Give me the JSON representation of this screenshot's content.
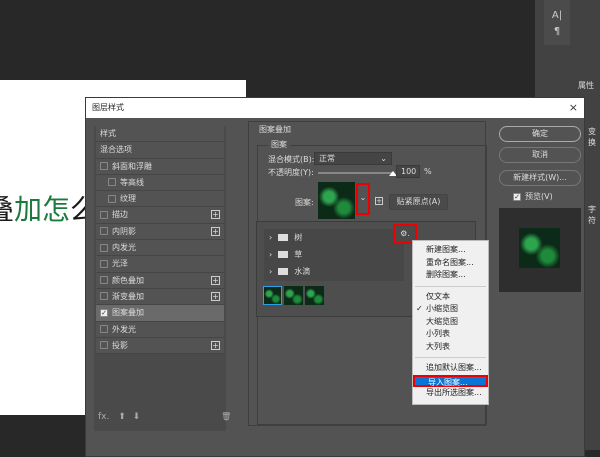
{
  "canvas": {
    "text_before": "叠",
    "text_green": "加怎",
    "text_after": "么"
  },
  "right_panel": {
    "tool_a": "A|",
    "tool_para": "¶",
    "properties_tab": "属性",
    "transform": "变换",
    "character": "字符"
  },
  "dialog": {
    "title": "图层样式",
    "close": "×",
    "styles": [
      {
        "label": "样式",
        "checkbox": false,
        "indent": false,
        "plus": false
      },
      {
        "label": "混合选项",
        "checkbox": false,
        "indent": false,
        "plus": false
      },
      {
        "label": "斜面和浮雕",
        "checkbox": true,
        "checked": false,
        "plus": false
      },
      {
        "label": "等高线",
        "checkbox": true,
        "checked": false,
        "indent": true,
        "plus": false
      },
      {
        "label": "纹理",
        "checkbox": true,
        "checked": false,
        "indent": true,
        "plus": false
      },
      {
        "label": "描边",
        "checkbox": true,
        "checked": false,
        "plus": true
      },
      {
        "label": "内阴影",
        "checkbox": true,
        "checked": false,
        "plus": true
      },
      {
        "label": "内发光",
        "checkbox": true,
        "checked": false,
        "plus": false
      },
      {
        "label": "光泽",
        "checkbox": true,
        "checked": false,
        "plus": false
      },
      {
        "label": "颜色叠加",
        "checkbox": true,
        "checked": false,
        "plus": true
      },
      {
        "label": "渐变叠加",
        "checkbox": true,
        "checked": false,
        "plus": true
      },
      {
        "label": "图案叠加",
        "checkbox": true,
        "checked": true,
        "plus": false,
        "selected": true
      },
      {
        "label": "外发光",
        "checkbox": true,
        "checked": false,
        "plus": false
      },
      {
        "label": "投影",
        "checkbox": true,
        "checked": false,
        "plus": true
      }
    ],
    "footer": {
      "fx": "fx.",
      "up": "⬆",
      "down": "⬇",
      "trash": "🗑"
    },
    "section_title": "图案叠加",
    "group_title": "图案",
    "blend_mode_label": "混合模式(B):",
    "blend_mode_value": "正常",
    "opacity_label": "不透明度(Y):",
    "opacity_value": "100",
    "opacity_unit": "%",
    "opacity_percent": 100,
    "pattern_label": "图案:",
    "snap_button": "贴紧原点(A)",
    "buttons": {
      "ok": "确定",
      "cancel": "取消",
      "new_style": "新建样式(W)...",
      "preview": "预览(V)"
    },
    "preview_checked": true
  },
  "pattern_picker": {
    "folders": [
      "树",
      "草",
      "水滴"
    ],
    "gear": "⚙.",
    "menu": {
      "group1": [
        "新建图案...",
        "重命名图案...",
        "删除图案..."
      ],
      "group2": [
        {
          "label": "仅文本",
          "checked": false
        },
        {
          "label": "小缩览图",
          "checked": true
        },
        {
          "label": "大缩览图",
          "checked": false
        },
        {
          "label": "小列表",
          "checked": false
        },
        {
          "label": "大列表",
          "checked": false
        }
      ],
      "group3": [
        "追加默认图案...",
        "导入图案...",
        "导出所选图案..."
      ],
      "highlighted": "导入图案..."
    }
  },
  "colors": {
    "highlight": "#0a75d6",
    "annotation": "#e00000"
  }
}
